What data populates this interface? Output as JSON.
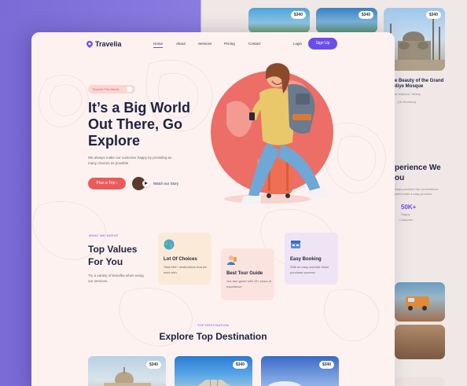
{
  "back": {
    "prices": [
      "$340",
      "$340",
      "$340"
    ],
    "mosque_title_1": "e Beauty of the Grand",
    "mosque_title_2": "diye Mosque",
    "mosque_location": "ar Istanbul, Turkey",
    "mosque_reviews": "(2k Reviews)",
    "experience_1": "perience We",
    "experience_2": "ou",
    "experience_desc": "ways prioritize the convenience joined with a easy process.",
    "stat_value": "50K+",
    "stat_label_1": "Happy",
    "stat_label_2": "Customer"
  },
  "nav": {
    "brand": "Travelia",
    "links": [
      "Home",
      "About",
      "Services",
      "Pricing",
      "Contact"
    ],
    "login": "Login",
    "signup": "Sign Up"
  },
  "hero": {
    "badge": "Explore The World",
    "title": "It’s a Big World Out There, Go Explore",
    "description": "We always make our customer happy by providing as many choices as possible",
    "cta": "Plan a Trip",
    "story": "Watch our Story"
  },
  "values": {
    "eyebrow": "WHAT WE SERVE",
    "title": "Top Values For You",
    "description": "Try a variety of benefits when using our services.",
    "cards": [
      {
        "title": "Lot Of Choices",
        "text": "Total 460+ destinations that we work with.",
        "icon": "globe-icon"
      },
      {
        "title": "Best Tour Guide",
        "text": "Our tour guide with 15+ years of experience.",
        "icon": "guide-icon"
      },
      {
        "title": "Easy Booking",
        "text": "With an easy and fast ticket purchase process.",
        "icon": "booking-icon"
      }
    ]
  },
  "destinations": {
    "eyebrow": "TOP DESTINATION",
    "title": "Explore Top Destination",
    "prices": [
      "$340",
      "$340",
      "$340"
    ]
  },
  "colors": {
    "accent": "#6a4dea",
    "coral": "#ec5b5b",
    "dark": "#1f2140",
    "page_bg": "#fdf2f0"
  }
}
